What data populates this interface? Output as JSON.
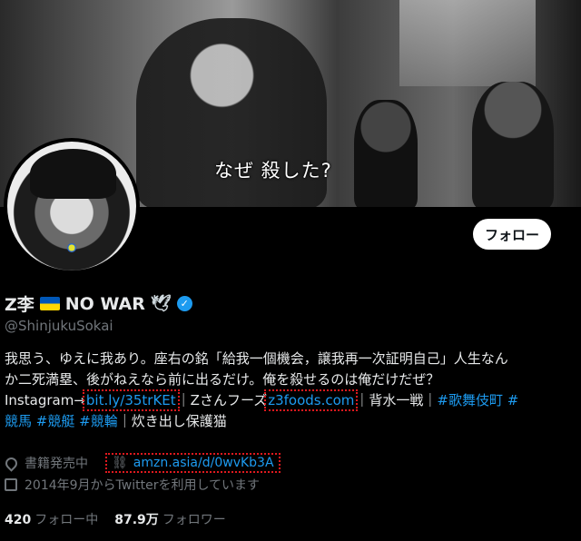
{
  "banner": {
    "caption": "なぜ 殺した?"
  },
  "header": {
    "follow_label": "フォロー"
  },
  "profile": {
    "name_prefix": "Z李",
    "name_suffix": "NO WAR",
    "dove_glyph": "🕊",
    "handle": "@ShinjukuSokai"
  },
  "bio": {
    "line1": "我思う、ゆえに我あり。座右の銘「給我一個機会，譲我再一次証明自己」人生なん",
    "line2": "か二死満塁、後がねえなら前に出るだけ。俺を殺せるのは俺だけだぜ？",
    "instagram_prefix": "Instagram→",
    "instagram_link": "bit.ly/35trKEt",
    "sep1": "｜Zさんフーズ",
    "foods_link": "z3foods.com",
    "sep2": "｜背水一戦｜",
    "tag1": "#歌舞伎町",
    "tag2_part": "#",
    "tag3": "競馬",
    "tag4": "#競艇",
    "tag5": "#競輪",
    "tail": "｜炊き出し保護猫"
  },
  "meta": {
    "location": "書籍発売中",
    "url": "amzn.asia/d/0wvKb3A",
    "joined": "2014年9月からTwitterを利用しています",
    "location_icon": "location-pin-icon",
    "link_icon": "link-icon",
    "calendar_icon": "calendar-icon"
  },
  "stats": {
    "following_count": "420",
    "following_label": "フォロー中",
    "followers_count": "87.9万",
    "followers_label": "フォロワー"
  },
  "colors": {
    "accent": "#1d9bf0",
    "highlight_box": "#e0191e",
    "background": "#000000"
  }
}
